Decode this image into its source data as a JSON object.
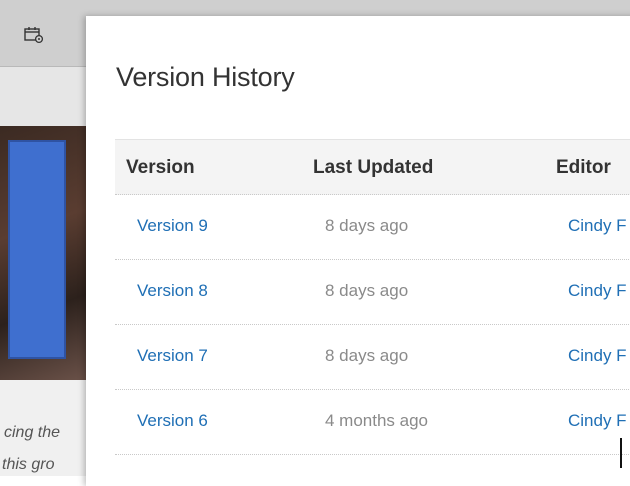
{
  "background": {
    "toolbar_icon": "calendar-settings-icon",
    "partial_text_line1": "cing the",
    "partial_text_line2": "this gro"
  },
  "modal": {
    "title": "Version History",
    "columns": [
      "Version",
      "Last Updated",
      "Editor"
    ],
    "rows": [
      {
        "version": "Version 9",
        "last_updated": "8 days ago",
        "editor": "Cindy F"
      },
      {
        "version": "Version 8",
        "last_updated": "8 days ago",
        "editor": "Cindy F"
      },
      {
        "version": "Version 7",
        "last_updated": "8 days ago",
        "editor": "Cindy F"
      },
      {
        "version": "Version 6",
        "last_updated": "4 months ago",
        "editor": "Cindy F"
      }
    ]
  },
  "colors": {
    "link": "#1f6fb5",
    "muted": "#8a8a8a",
    "heading": "#333333"
  }
}
